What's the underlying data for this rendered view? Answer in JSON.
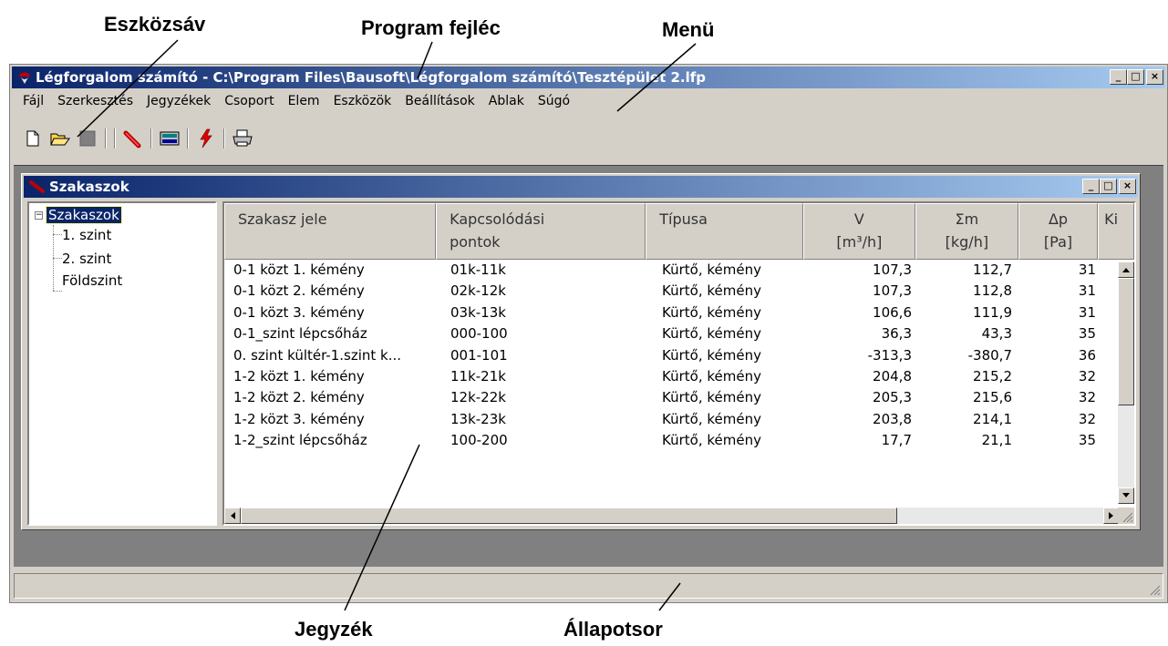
{
  "callouts": {
    "toolbar_label": "Eszközsáv",
    "header_label": "Program fejléc",
    "menu_label": "Menü",
    "list_label": "Jegyzék",
    "status_label": "Állapotsor"
  },
  "window": {
    "title": "Légforgalom számító - C:\\Program Files\\Bausoft\\Légforgalom számító\\Tesztépület 2.lfp",
    "minimize": "_",
    "maximize": "□",
    "close": "×"
  },
  "menu": [
    "Fájl",
    "Szerkesztés",
    "Jegyzékek",
    "Csoport",
    "Elem",
    "Eszközök",
    "Beállítások",
    "Ablak",
    "Súgó"
  ],
  "toolbar": {
    "icons": [
      "new-document-icon",
      "open-folder-icon",
      "save-icon",
      "pipe-section-icon",
      "calculator-icon",
      "calculate-lightning-icon",
      "print-icon"
    ]
  },
  "child": {
    "title": "Szakaszok",
    "minimize": "_",
    "maximize": "□",
    "close": "×"
  },
  "tree": {
    "root": "Szakaszok",
    "expander": "−",
    "children": [
      "1. szint",
      "2. szint",
      "Földszint"
    ]
  },
  "list": {
    "columns": [
      {
        "label": "Szakasz jele"
      },
      {
        "label": "Kapcsolódási\npontok"
      },
      {
        "label": "Típusa"
      },
      {
        "label": "V\n[m³/h]"
      },
      {
        "label": "Σm\n[kg/h]"
      },
      {
        "label": "Δp\n[Pa]"
      },
      {
        "label": "Ki"
      }
    ],
    "rows": [
      {
        "jele": "0-1 közt 1. kémény",
        "pontok": "01k-11k",
        "tipus": "Kürtő, kémény",
        "v": "107,3",
        "m": "112,7",
        "p": "31"
      },
      {
        "jele": "0-1 közt 2. kémény",
        "pontok": "02k-12k",
        "tipus": "Kürtő, kémény",
        "v": "107,3",
        "m": "112,8",
        "p": "31"
      },
      {
        "jele": "0-1 közt 3. kémény",
        "pontok": "03k-13k",
        "tipus": "Kürtő, kémény",
        "v": "106,6",
        "m": "111,9",
        "p": "31"
      },
      {
        "jele": "0-1_szint lépcsőház",
        "pontok": "000-100",
        "tipus": "Kürtő, kémény",
        "v": "36,3",
        "m": "43,3",
        "p": "35"
      },
      {
        "jele": "0. szint kültér-1.szint k...",
        "pontok": "001-101",
        "tipus": "Kürtő, kémény",
        "v": "-313,3",
        "m": "-380,7",
        "p": "36"
      },
      {
        "jele": "1-2 közt 1. kémény",
        "pontok": "11k-21k",
        "tipus": "Kürtő, kémény",
        "v": "204,8",
        "m": "215,2",
        "p": "32"
      },
      {
        "jele": "1-2 közt 2. kémény",
        "pontok": "12k-22k",
        "tipus": "Kürtő, kémény",
        "v": "205,3",
        "m": "215,6",
        "p": "32"
      },
      {
        "jele": "1-2 közt 3. kémény",
        "pontok": "13k-23k",
        "tipus": "Kürtő, kémény",
        "v": "203,8",
        "m": "214,1",
        "p": "32"
      },
      {
        "jele": "1-2_szint lépcsőház",
        "pontok": "100-200",
        "tipus": "Kürtő, kémény",
        "v": "17,7",
        "m": "21,1",
        "p": "35"
      }
    ]
  },
  "status": {
    "text": ""
  }
}
